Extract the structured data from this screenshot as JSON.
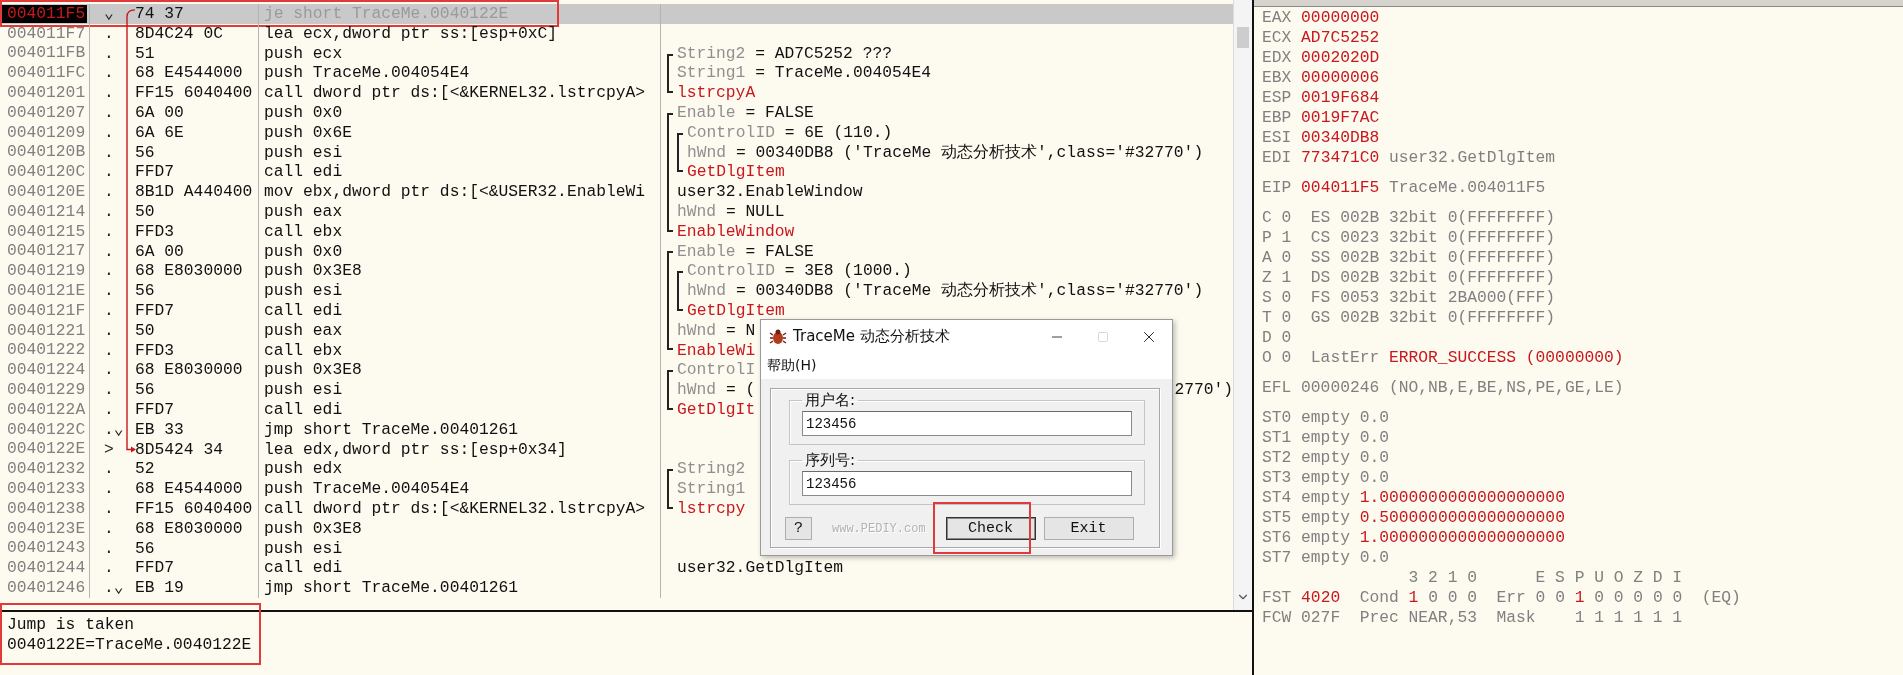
{
  "disassembly": {
    "rows": [
      {
        "address": "004011F5",
        "marker": "⌄",
        "hex": "74 37",
        "instruction": "je short TraceMe.0040122E",
        "selected": true,
        "annotated": true,
        "jump_from": true
      },
      {
        "address": "004011F7",
        "marker": ".",
        "hex": "8D4C24 0C",
        "instruction": "lea ecx,dword ptr ss:[esp+0xC]",
        "selected": false,
        "annotated": false
      },
      {
        "address": "004011FB",
        "marker": ".",
        "hex": "51",
        "instruction": "push ecx",
        "selected": false,
        "annotated": false,
        "comment": {
          "kind": "arg",
          "label": "String2",
          "value": "= AD7C5252 ???",
          "bracket": {
            "first": true,
            "last": false
          }
        }
      },
      {
        "address": "004011FC",
        "marker": ".",
        "hex": "68 E4544000",
        "instruction": "push TraceMe.004054E4",
        "selected": false,
        "annotated": false,
        "comment": {
          "kind": "arg",
          "label": "String1",
          "value": "= TraceMe.004054E4",
          "bracket": {
            "first": false,
            "last": false
          }
        }
      },
      {
        "address": "00401201",
        "marker": ".",
        "hex": "FF15 6040400",
        "instruction": "call dword ptr ds:[<&KERNEL32.lstrcpyA>",
        "selected": false,
        "annotated": false,
        "comment": {
          "kind": "call",
          "text": "lstrcpyA",
          "bracket": {
            "first": false,
            "last": true
          }
        }
      },
      {
        "address": "00401207",
        "marker": ".",
        "hex": "6A 00",
        "instruction": "push 0x0",
        "selected": false,
        "annotated": false,
        "comment": {
          "kind": "arg",
          "label": "Enable",
          "value": "= FALSE",
          "bracket": {
            "first": true,
            "last": false
          }
        }
      },
      {
        "address": "00401209",
        "marker": ".",
        "hex": "6A 6E",
        "instruction": "push 0x6E",
        "selected": false,
        "annotated": false,
        "comment": {
          "kind": "arg",
          "label": "ControlID",
          "value": "= 6E (110.)",
          "bracket": {
            "first": false,
            "last": false
          },
          "inner": {
            "first": true,
            "last": false
          }
        }
      },
      {
        "address": "0040120B",
        "marker": ".",
        "hex": "56",
        "instruction": "push esi",
        "selected": false,
        "annotated": false,
        "comment": {
          "kind": "arg",
          "label": "hWnd",
          "value": "= 00340DB8 ('TraceMe 动态分析技术',class='#32770')",
          "bracket": {
            "first": false,
            "last": false
          },
          "inner": {
            "first": false,
            "last": false
          }
        }
      },
      {
        "address": "0040120C",
        "marker": ".",
        "hex": "FFD7",
        "instruction": "call edi",
        "selected": false,
        "annotated": false,
        "comment": {
          "kind": "call",
          "text": "GetDlgItem",
          "bracket": {
            "first": false,
            "last": false
          },
          "inner": {
            "first": false,
            "last": true
          }
        }
      },
      {
        "address": "0040120E",
        "marker": ".",
        "hex": "8B1D A440400",
        "instruction": "mov ebx,dword ptr ds:[<&USER32.EnableWi",
        "selected": false,
        "annotated": false,
        "comment": {
          "kind": "plain",
          "text": "user32.EnableWindow",
          "bracket": {
            "first": false,
            "last": false
          }
        }
      },
      {
        "address": "00401214",
        "marker": ".",
        "hex": "50",
        "instruction": "push eax",
        "selected": false,
        "annotated": false,
        "comment": {
          "kind": "arg",
          "label": "hWnd",
          "value": "= NULL",
          "bracket": {
            "first": false,
            "last": false
          }
        }
      },
      {
        "address": "00401215",
        "marker": ".",
        "hex": "FFD3",
        "instruction": "call ebx",
        "selected": false,
        "annotated": false,
        "comment": {
          "kind": "call",
          "text": "EnableWindow",
          "bracket": {
            "first": false,
            "last": true
          }
        }
      },
      {
        "address": "00401217",
        "marker": ".",
        "hex": "6A 00",
        "instruction": "push 0x0",
        "selected": false,
        "annotated": false,
        "comment": {
          "kind": "arg",
          "label": "Enable",
          "value": "= FALSE",
          "bracket": {
            "first": true,
            "last": false
          }
        }
      },
      {
        "address": "00401219",
        "marker": ".",
        "hex": "68 E8030000",
        "instruction": "push 0x3E8",
        "selected": false,
        "annotated": false,
        "comment": {
          "kind": "arg",
          "label": "ControlID",
          "value": "= 3E8 (1000.)",
          "bracket": {
            "first": false,
            "last": false
          },
          "inner": {
            "first": true,
            "last": false
          }
        }
      },
      {
        "address": "0040121E",
        "marker": ".",
        "hex": "56",
        "instruction": "push esi",
        "selected": false,
        "annotated": false,
        "comment": {
          "kind": "arg",
          "label": "hWnd",
          "value": "= 00340DB8 ('TraceMe 动态分析技术',class='#32770')",
          "bracket": {
            "first": false,
            "last": false
          },
          "inner": {
            "first": false,
            "last": false
          }
        }
      },
      {
        "address": "0040121F",
        "marker": ".",
        "hex": "FFD7",
        "instruction": "call edi",
        "selected": false,
        "annotated": false,
        "comment": {
          "kind": "call",
          "text": "GetDlgItem",
          "bracket": {
            "first": false,
            "last": false
          },
          "inner": {
            "first": false,
            "last": true
          }
        }
      },
      {
        "address": "00401221",
        "marker": ".",
        "hex": "50",
        "instruction": "push eax",
        "selected": false,
        "annotated": false,
        "comment": {
          "kind": "arg",
          "label": "hWnd",
          "value": "= N",
          "bracket": {
            "first": false,
            "last": false
          }
        }
      },
      {
        "address": "00401222",
        "marker": ".",
        "hex": "FFD3",
        "instruction": "call ebx",
        "selected": false,
        "annotated": false,
        "comment": {
          "kind": "call",
          "text": "EnableWi",
          "bracket": {
            "first": false,
            "last": true
          }
        }
      },
      {
        "address": "00401224",
        "marker": ".",
        "hex": "68 E8030000",
        "instruction": "push 0x3E8",
        "selected": false,
        "annotated": false,
        "comment": {
          "kind": "arg",
          "label": "ControlI",
          "bracket": {
            "first": true,
            "last": false
          }
        }
      },
      {
        "address": "00401229",
        "marker": ".",
        "hex": "56",
        "instruction": "push esi",
        "selected": false,
        "annotated": false,
        "comment": {
          "kind": "arg",
          "label": "hWnd",
          "value": "= (",
          "tail": "2770')",
          "bracket": {
            "first": false,
            "last": false
          }
        }
      },
      {
        "address": "0040122A",
        "marker": ".",
        "hex": "FFD7",
        "instruction": "call edi",
        "selected": false,
        "annotated": false,
        "comment": {
          "kind": "call",
          "text": "GetDlgIt",
          "bracket": {
            "first": false,
            "last": true
          }
        }
      },
      {
        "address": "0040122C",
        "marker": ".⌄",
        "hex": "EB 33",
        "instruction": "jmp short TraceMe.00401261",
        "selected": false,
        "annotated": false
      },
      {
        "address": "0040122E",
        "marker": ">",
        "hex": "8D5424 34",
        "instruction": "lea edx,dword ptr ss:[esp+0x34]",
        "selected": false,
        "annotated": false,
        "jump_to": true
      },
      {
        "address": "00401232",
        "marker": ".",
        "hex": "52",
        "instruction": "push edx",
        "selected": false,
        "annotated": false,
        "comment": {
          "kind": "arg",
          "label": "String2",
          "bracket": {
            "first": true,
            "last": false
          }
        }
      },
      {
        "address": "00401233",
        "marker": ".",
        "hex": "68 E4544000",
        "instruction": "push TraceMe.004054E4",
        "selected": false,
        "annotated": false,
        "comment": {
          "kind": "arg",
          "label": "String1",
          "bracket": {
            "first": false,
            "last": false
          }
        }
      },
      {
        "address": "00401238",
        "marker": ".",
        "hex": "FF15 6040400",
        "instruction": "call dword ptr ds:[<&KERNEL32.lstrcpyA>",
        "selected": false,
        "annotated": false,
        "comment": {
          "kind": "call",
          "text": "lstrcpy",
          "bracket": {
            "first": false,
            "last": true
          }
        }
      },
      {
        "address": "0040123E",
        "marker": ".",
        "hex": "68 E8030000",
        "instruction": "push 0x3E8",
        "selected": false,
        "annotated": false
      },
      {
        "address": "00401243",
        "marker": ".",
        "hex": "56",
        "instruction": "push esi",
        "selected": false,
        "annotated": false
      },
      {
        "address": "00401244",
        "marker": ".",
        "hex": "FFD7",
        "instruction": "call edi",
        "selected": false,
        "annotated": false,
        "comment": {
          "kind": "plain",
          "text": "user32.GetDlgItem"
        }
      },
      {
        "address": "00401246",
        "marker": ".⌄",
        "hex": "EB 19",
        "instruction": "jmp short TraceMe.00401261",
        "selected": false,
        "annotated": false
      }
    ]
  },
  "info": {
    "lines": [
      "Jump is taken",
      "0040122E=TraceMe.0040122E"
    ],
    "annotated": true
  },
  "registers": {
    "groups": [
      {
        "lines": [
          {
            "parts": [
              {
                "text": "EAX ",
                "changed": false
              },
              {
                "text": "00000000",
                "changed": true
              }
            ]
          },
          {
            "parts": [
              {
                "text": "ECX ",
                "changed": false
              },
              {
                "text": "AD7C5252",
                "changed": true
              }
            ]
          },
          {
            "parts": [
              {
                "text": "EDX ",
                "changed": false
              },
              {
                "text": "0002020D",
                "changed": true
              }
            ]
          },
          {
            "parts": [
              {
                "text": "EBX ",
                "changed": false
              },
              {
                "text": "00000006",
                "changed": true
              }
            ]
          },
          {
            "parts": [
              {
                "text": "ESP ",
                "changed": false
              },
              {
                "text": "0019F684",
                "changed": true
              }
            ]
          },
          {
            "parts": [
              {
                "text": "EBP ",
                "changed": false
              },
              {
                "text": "0019F7AC",
                "changed": true
              }
            ]
          },
          {
            "parts": [
              {
                "text": "ESI ",
                "changed": false
              },
              {
                "text": "00340DB8",
                "changed": true
              }
            ]
          },
          {
            "parts": [
              {
                "text": "EDI ",
                "changed": false
              },
              {
                "text": "773471C0",
                "changed": true
              },
              {
                "text": " user32.GetDlgItem",
                "changed": false
              }
            ]
          }
        ]
      },
      {
        "lines": [
          {
            "parts": [
              {
                "text": "EIP ",
                "changed": false
              },
              {
                "text": "004011F5",
                "changed": true
              },
              {
                "text": " TraceMe.004011F5",
                "changed": false
              }
            ]
          }
        ]
      },
      {
        "lines": [
          {
            "parts": [
              {
                "text": "C 0  ES 002B 32bit 0(FFFFFFFF)",
                "changed": false
              }
            ]
          },
          {
            "parts": [
              {
                "text": "P 1  CS 0023 32bit 0(FFFFFFFF)",
                "changed": false
              }
            ]
          },
          {
            "parts": [
              {
                "text": "A 0  SS 002B 32bit 0(FFFFFFFF)",
                "changed": false
              }
            ]
          },
          {
            "parts": [
              {
                "text": "Z 1  DS 002B 32bit 0(FFFFFFFF)",
                "changed": false
              }
            ]
          },
          {
            "parts": [
              {
                "text": "S 0  FS 0053 32bit 2BA000(FFF)",
                "changed": false
              }
            ]
          },
          {
            "parts": [
              {
                "text": "T 0  GS 002B 32bit 0(FFFFFFFF)",
                "changed": false
              }
            ]
          },
          {
            "parts": [
              {
                "text": "D 0",
                "changed": false
              }
            ]
          },
          {
            "parts": [
              {
                "text": "O 0  LastErr ",
                "changed": false
              },
              {
                "text": "ERROR_SUCCESS (00000000)",
                "changed": true
              }
            ]
          }
        ]
      },
      {
        "lines": [
          {
            "parts": [
              {
                "text": "EFL 00000246 (NO,NB,E,BE,NS,PE,GE,LE)",
                "changed": false
              }
            ]
          }
        ]
      },
      {
        "lines": [
          {
            "parts": [
              {
                "text": "ST0 empty 0.0",
                "changed": false
              }
            ]
          },
          {
            "parts": [
              {
                "text": "ST1 empty 0.0",
                "changed": false
              }
            ]
          },
          {
            "parts": [
              {
                "text": "ST2 empty 0.0",
                "changed": false
              }
            ]
          },
          {
            "parts": [
              {
                "text": "ST3 empty 0.0",
                "changed": false
              }
            ]
          },
          {
            "parts": [
              {
                "text": "ST4 empty ",
                "changed": false
              },
              {
                "text": "1.0000000000000000000",
                "changed": true
              }
            ]
          },
          {
            "parts": [
              {
                "text": "ST5 empty ",
                "changed": false
              },
              {
                "text": "0.5000000000000000000",
                "changed": true
              }
            ]
          },
          {
            "parts": [
              {
                "text": "ST6 empty ",
                "changed": false
              },
              {
                "text": "1.0000000000000000000",
                "changed": true
              }
            ]
          },
          {
            "parts": [
              {
                "text": "ST7 empty 0.0",
                "changed": false
              }
            ]
          },
          {
            "parts": [
              {
                "text": "               3 2 1 0      E S P U O Z D I",
                "changed": false
              }
            ]
          },
          {
            "parts": [
              {
                "text": "FST ",
                "changed": false
              },
              {
                "text": "4020",
                "changed": true
              },
              {
                "text": "  Cond ",
                "changed": false
              },
              {
                "text": "1",
                "changed": true
              },
              {
                "text": " 0 0 0  Err 0 0 ",
                "changed": false
              },
              {
                "text": "1",
                "changed": true
              },
              {
                "text": " 0 0 0 0 0  (EQ)",
                "changed": false
              }
            ]
          },
          {
            "parts": [
              {
                "text": "FCW 027F  Prec NEAR,53  Mask    1 1 1 1 1 1",
                "changed": false
              }
            ]
          }
        ]
      }
    ]
  },
  "dialog": {
    "title": "TraceMe 动态分析技术",
    "maximize_disabled": true,
    "menu": [
      "帮助(H)"
    ],
    "fields": [
      {
        "label": "用户名:",
        "value": "123456"
      },
      {
        "label": "序列号:",
        "value": "123456"
      }
    ],
    "help_button": "?",
    "site": "www.PEDIY.com",
    "buttons": [
      {
        "label": "Check",
        "focused": true,
        "annotated": true
      },
      {
        "label": "Exit",
        "focused": false,
        "annotated": false
      }
    ]
  }
}
